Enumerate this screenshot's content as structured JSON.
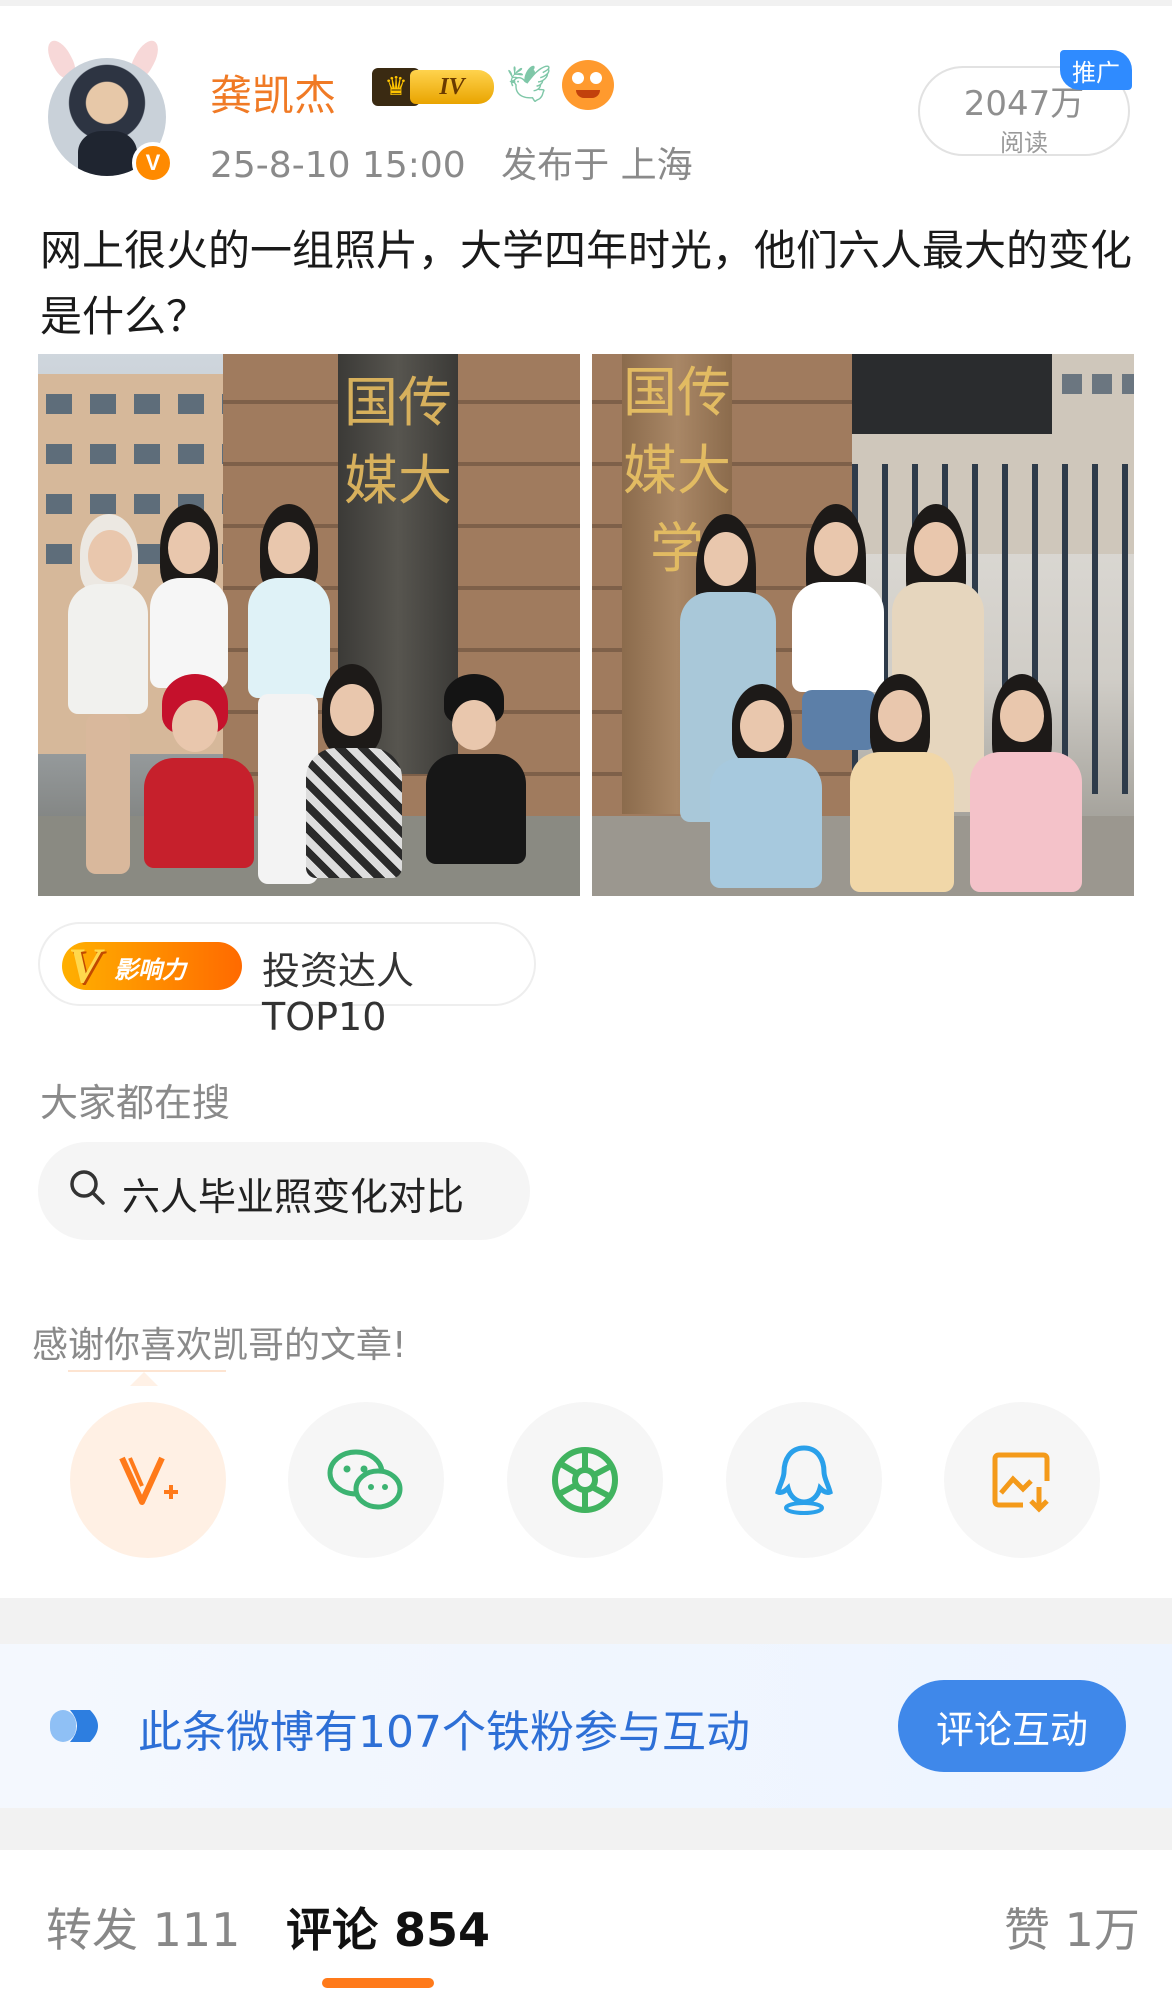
{
  "post": {
    "author": "龚凯杰",
    "level_badge": "IV",
    "verified_badge": "V",
    "time": "25-8-10 15:00",
    "location": "发布于 上海",
    "read_count": "2047万",
    "read_label": "阅读",
    "promo_badge": "推广",
    "text": "网上很火的一组照片，大学四年时光，他们六人最大的变化是什么？",
    "photo_left_caption": "国传媒大",
    "photo_right_caption": "国传媒大学"
  },
  "influence_tag": {
    "badge_text": "影响力",
    "label": "投资达人TOP10"
  },
  "search": {
    "title": "大家都在搜",
    "query": "六人毕业照变化对比"
  },
  "thanks_text": "感谢你喜欢凯哥的文章!",
  "share_icons": [
    "v-plus-icon",
    "wechat-icon",
    "moments-icon",
    "qq-icon",
    "save-image-icon"
  ],
  "fans": {
    "text": "此条微博有107个铁粉参与互动",
    "button": "评论互动"
  },
  "tabs": {
    "repost": "转发 111",
    "comment": "评论 854",
    "like": "赞 1万"
  },
  "colors": {
    "author": "#f07a25",
    "accent_orange": "#ff7a1a",
    "fans_blue": "#2d6fd6",
    "button_blue": "#3f88ea"
  }
}
